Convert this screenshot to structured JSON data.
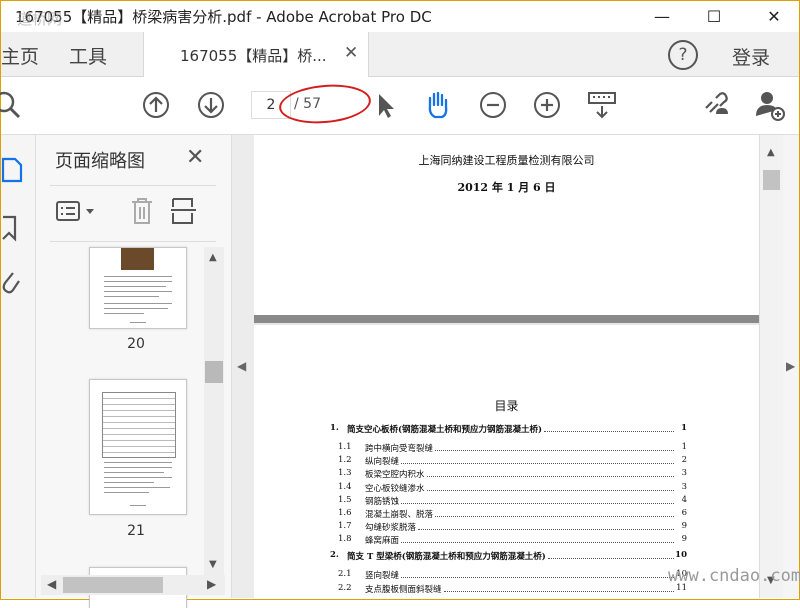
{
  "window": {
    "title": "167055【精品】桥梁病害分析.pdf - Adobe Acrobat Pro DC",
    "minimize": "—",
    "maximize": "☐",
    "close": "✕"
  },
  "tabs": {
    "home": "主页",
    "tools": "工具",
    "document": "167055【精品】桥...",
    "close": "✕",
    "help": "?",
    "login": "登录"
  },
  "toolbar": {
    "current_page": "2",
    "page_total": "/ 57",
    "icons": [
      "search-icon",
      "page-up-icon",
      "page-down-icon",
      "select-cursor-icon",
      "hand-tool-icon",
      "zoom-out-icon",
      "zoom-in-icon",
      "keyboard-scroll-icon",
      "share-link-icon",
      "add-user-icon"
    ]
  },
  "thumbnails_panel": {
    "title": "页面缩略图",
    "close": "✕",
    "pages": [
      {
        "number": "20"
      },
      {
        "number": "21"
      }
    ]
  },
  "document": {
    "page1": {
      "company": "上海同纳建设工程质量检测有限公司",
      "date": "2012 年 1 月 6 日"
    },
    "page2": {
      "toc_title": "目录",
      "toc": [
        {
          "num": "1.",
          "title": "简支空心板桥(钢筋混凝土桥和预应力钢筋混凝土桥)",
          "page": "1",
          "bold": true
        },
        {
          "num": "1.1",
          "title": "跨中横向受弯裂缝",
          "page": "1",
          "bold": false
        },
        {
          "num": "1.2",
          "title": "纵向裂缝",
          "page": "2",
          "bold": false
        },
        {
          "num": "1.3",
          "title": "板梁空腔内积水",
          "page": "3",
          "bold": false
        },
        {
          "num": "1.4",
          "title": "空心板铰缝渗水",
          "page": "3",
          "bold": false
        },
        {
          "num": "1.5",
          "title": "钢筋锈蚀",
          "page": "4",
          "bold": false
        },
        {
          "num": "1.6",
          "title": "混凝土崩裂、脱落",
          "page": "6",
          "bold": false
        },
        {
          "num": "1.7",
          "title": "勾缝砂浆脱落",
          "page": "9",
          "bold": false
        },
        {
          "num": "1.8",
          "title": "蜂窝麻面",
          "page": "9",
          "bold": false
        },
        {
          "num": "2.",
          "title": "简支 T 型梁桥(钢筋混凝土桥和预应力钢筋混凝土桥)",
          "page": "10",
          "bold": true
        },
        {
          "num": "2.1",
          "title": "竖向裂缝",
          "page": "10",
          "bold": false
        },
        {
          "num": "2.2",
          "title": "支点腹板侧面斜裂缝",
          "page": "11",
          "bold": false
        }
      ]
    }
  },
  "watermarks": {
    "top_left": "道桥网",
    "bottom_right": "www.cndao.com"
  },
  "colors": {
    "frame": "#e0a100",
    "annotation_oval": "#d51d1d",
    "hand_tool": "#1473e6"
  }
}
